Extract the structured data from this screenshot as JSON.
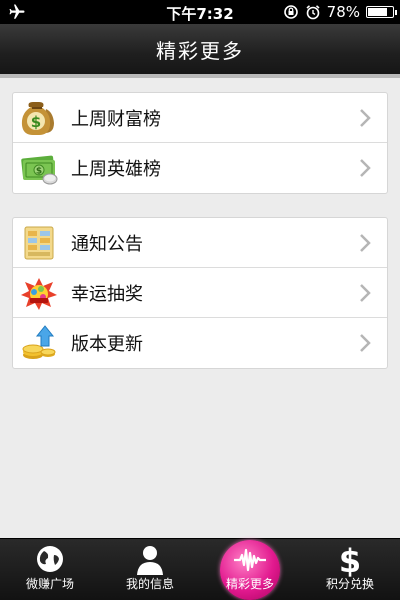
{
  "status_bar": {
    "time": "下午7:32",
    "battery": "78%",
    "battery_level": 0.78
  },
  "nav": {
    "title": "精彩更多"
  },
  "groups": [
    {
      "items": [
        {
          "label": "上周财富榜",
          "icon": "money-bag-icon"
        },
        {
          "label": "上周英雄榜",
          "icon": "cash-coin-icon"
        }
      ]
    },
    {
      "items": [
        {
          "label": "通知公告",
          "icon": "notice-board-icon"
        },
        {
          "label": "幸运抽奖",
          "icon": "lottery-icon"
        },
        {
          "label": "版本更新",
          "icon": "coins-arrow-icon"
        }
      ]
    }
  ],
  "tabs": [
    {
      "label": "微赚广场",
      "icon": "globe-icon",
      "active": false
    },
    {
      "label": "我的信息",
      "icon": "person-icon",
      "active": false
    },
    {
      "label": "精彩更多",
      "icon": "sound-wave-icon",
      "active": true
    },
    {
      "label": "积分兑换",
      "icon": "dollar-icon",
      "active": false
    }
  ],
  "colors": {
    "active_tab": "#e21a8f",
    "nav_bg": "#1f1f1f",
    "page_bg": "#ececec"
  }
}
